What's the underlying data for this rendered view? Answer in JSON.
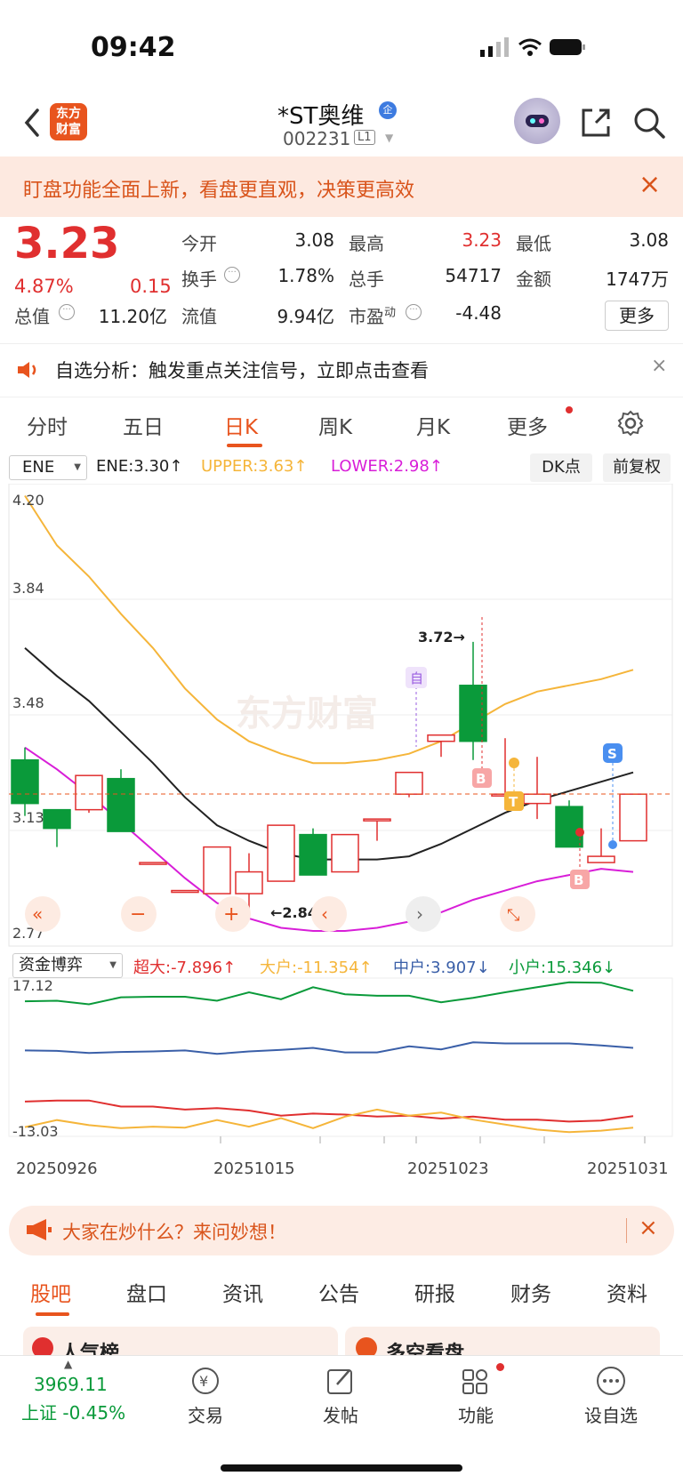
{
  "status": {
    "time": "09:42"
  },
  "header": {
    "logo_line1": "东方",
    "logo_line2": "财富",
    "name": "*ST奥维",
    "badge": "企",
    "code": "002231",
    "level": "L1"
  },
  "promo": {
    "text": "盯盘功能全面上新，看盘更直观，决策更高效"
  },
  "quote": {
    "price": "3.23",
    "pct": "4.87%",
    "change": "0.15",
    "open_label": "今开",
    "open": "3.08",
    "high_label": "最高",
    "high": "3.23",
    "low_label": "最低",
    "low": "3.08",
    "turnover_label": "换手",
    "turnover": "1.78%",
    "volume_label": "总手",
    "volume": "54717",
    "amount_label": "金额",
    "amount": "1747万",
    "mktcap_label": "总值",
    "mktcap": "11.20亿",
    "float_label": "流值",
    "float": "9.94亿",
    "pe_label": "市盈",
    "pe_sup": "动",
    "pe": "-4.48",
    "more": "更多"
  },
  "analysis": {
    "text": "自选分析：触发重点关注信号，立即点击查看"
  },
  "tabs": [
    "分时",
    "五日",
    "日K",
    "周K",
    "月K",
    "更多"
  ],
  "indicator": {
    "name": "ENE",
    "ene": "ENE:3.30↑",
    "upper": "UPPER:3.63↑",
    "lower": "LOWER:2.98↑",
    "dk": "DK点",
    "adjust": "前复权"
  },
  "axis": {
    "y1": "4.20",
    "y2": "3.84",
    "y3": "3.48",
    "y4": "3.13",
    "y5": "2.77",
    "hi_label": "3.72→",
    "lo_label": "←2.84",
    "watermark": "东方财富"
  },
  "markers": {
    "zi": "自",
    "b": "B",
    "t": "T",
    "s": "S"
  },
  "fund": {
    "name": "资金博弈",
    "super": "超大:-7.896↑",
    "big": "大户:-11.354↑",
    "mid": "中户:3.907↓",
    "small": "小户:15.346↓",
    "top": "17.12",
    "bottom": "-13.03"
  },
  "dates": [
    "20250926",
    "20251015",
    "20251023",
    "20251031"
  ],
  "banner": {
    "text": "大家在炒什么？来问妙想！"
  },
  "bottom_tabs": [
    "股吧",
    "盘口",
    "资讯",
    "公告",
    "研报",
    "财务",
    "资料"
  ],
  "peek": {
    "left": "人气榜",
    "right": "多空看盘"
  },
  "dock": {
    "index_value": "3969.11",
    "index_name": "上证 -0.45%",
    "trade": "交易",
    "post": "发帖",
    "func": "功能",
    "watch": "设自选"
  },
  "colors": {
    "up": "#e02f2f",
    "down": "#0a9a3a",
    "accent": "#e8541e",
    "upper": "#f5b53a",
    "lower": "#d81ed8"
  },
  "chart_data": {
    "type": "candlestick",
    "ylim": [
      2.77,
      4.2
    ],
    "candles": [
      {
        "o": 3.34,
        "c": 3.2,
        "h": 3.38,
        "l": 3.16
      },
      {
        "o": 3.18,
        "c": 3.12,
        "h": 3.18,
        "l": 3.06
      },
      {
        "o": 3.18,
        "c": 3.29,
        "h": 3.29,
        "l": 3.17
      },
      {
        "o": 3.28,
        "c": 3.11,
        "h": 3.31,
        "l": 3.11
      },
      {
        "o": 3.01,
        "c": 3.01,
        "h": 3.01,
        "l": 3.01
      },
      {
        "o": 2.92,
        "c": 2.92,
        "h": 2.92,
        "l": 2.92
      },
      {
        "o": 2.91,
        "c": 3.06,
        "h": 3.06,
        "l": 2.91
      },
      {
        "o": 2.91,
        "c": 2.98,
        "h": 3.04,
        "l": 2.84
      },
      {
        "o": 2.95,
        "c": 3.13,
        "h": 3.13,
        "l": 2.95
      },
      {
        "o": 3.1,
        "c": 2.97,
        "h": 3.12,
        "l": 2.97
      },
      {
        "o": 2.98,
        "c": 3.1,
        "h": 3.1,
        "l": 2.98
      },
      {
        "o": 3.15,
        "c": 3.15,
        "h": 3.15,
        "l": 3.08
      },
      {
        "o": 3.23,
        "c": 3.3,
        "h": 3.3,
        "l": 3.22
      },
      {
        "o": 3.4,
        "c": 3.42,
        "h": 3.42,
        "l": 3.35
      },
      {
        "o": 3.58,
        "c": 3.4,
        "h": 3.72,
        "l": 3.34
      },
      {
        "o": 3.23,
        "c": 3.23,
        "h": 3.41,
        "l": 3.18
      },
      {
        "o": 3.2,
        "c": 3.23,
        "h": 3.35,
        "l": 3.15
      },
      {
        "o": 3.19,
        "c": 3.06,
        "h": 3.21,
        "l": 3.06
      },
      {
        "o": 3.01,
        "c": 3.03,
        "h": 3.12,
        "l": 3.01
      },
      {
        "o": 3.08,
        "c": 3.23,
        "h": 3.23,
        "l": 3.08
      }
    ],
    "ene": [
      3.7,
      3.61,
      3.53,
      3.43,
      3.33,
      3.22,
      3.13,
      3.08,
      3.04,
      3.02,
      3.02,
      3.02,
      3.03,
      3.07,
      3.12,
      3.17,
      3.21,
      3.24,
      3.27,
      3.3
    ],
    "upper": [
      4.19,
      4.03,
      3.93,
      3.81,
      3.7,
      3.57,
      3.47,
      3.4,
      3.36,
      3.33,
      3.33,
      3.34,
      3.36,
      3.4,
      3.46,
      3.52,
      3.56,
      3.58,
      3.6,
      3.63
    ],
    "lower": [
      3.38,
      3.31,
      3.23,
      3.14,
      3.05,
      2.96,
      2.88,
      2.83,
      2.8,
      2.79,
      2.79,
      2.8,
      2.82,
      2.85,
      2.89,
      2.92,
      2.95,
      2.97,
      2.99,
      2.98
    ]
  }
}
